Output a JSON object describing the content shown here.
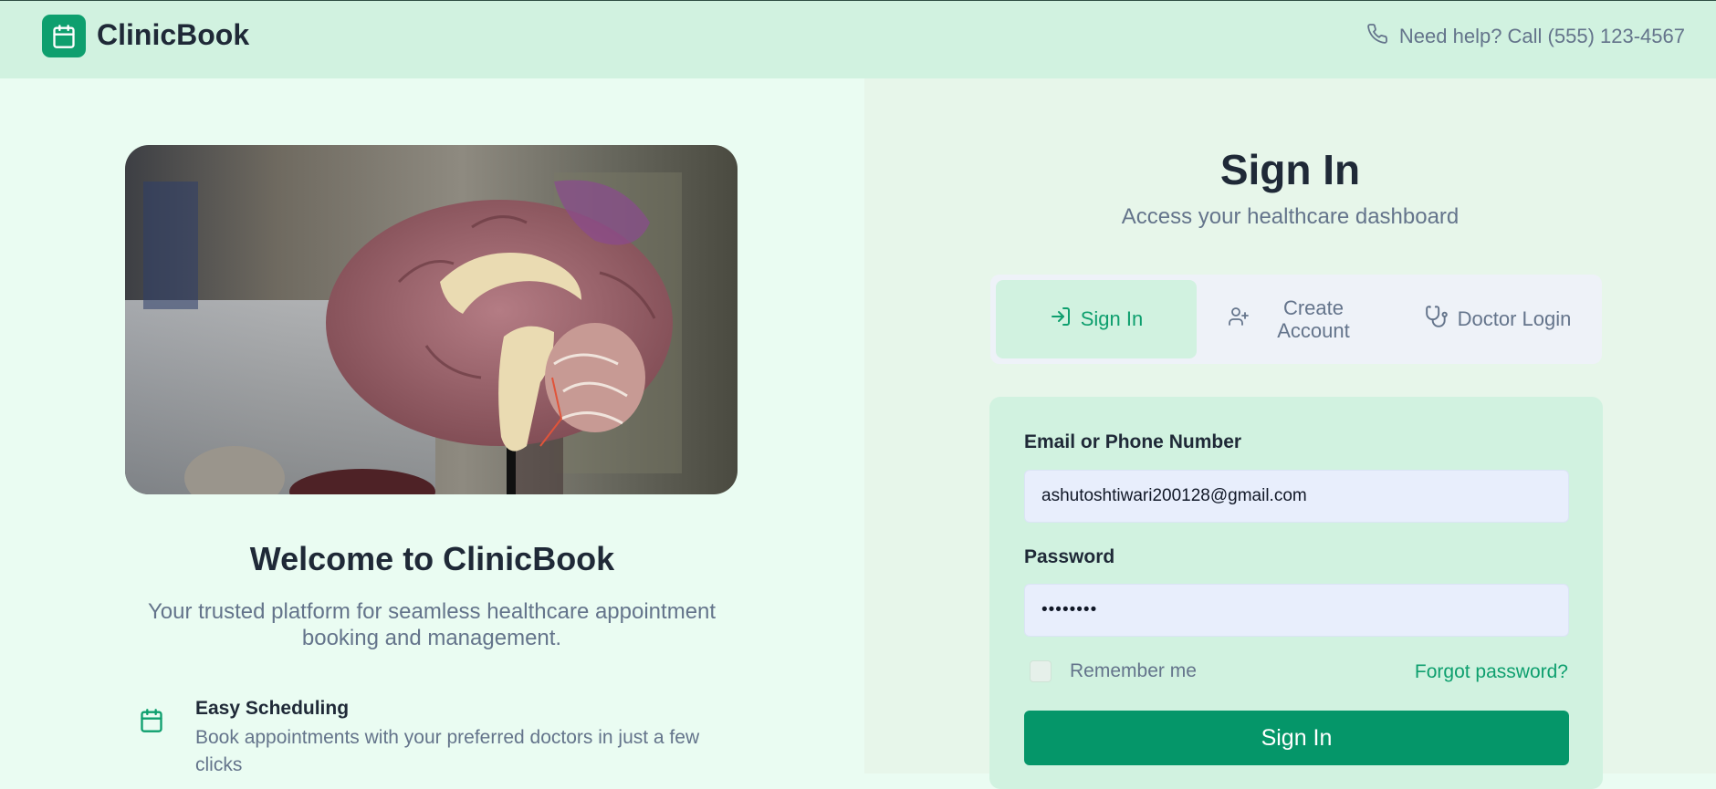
{
  "header": {
    "brand": "ClinicBook",
    "help_text": "Need help? Call (555) 123-4567"
  },
  "left": {
    "welcome_title": "Welcome to ClinicBook",
    "subtitle": "Your trusted platform for seamless healthcare appointment booking and management.",
    "feature": {
      "title": "Easy Scheduling",
      "description": "Book appointments with your preferred doctors in just a few clicks"
    }
  },
  "auth": {
    "title": "Sign In",
    "subtitle": "Access your healthcare dashboard",
    "tabs": [
      {
        "label": "Sign In",
        "icon": "sign-in-icon",
        "active": true
      },
      {
        "label": "Create Account",
        "icon": "user-plus-icon",
        "active": false
      },
      {
        "label": "Doctor Login",
        "icon": "stethoscope-icon",
        "active": false
      }
    ],
    "form": {
      "email_label": "Email or Phone Number",
      "email_value": "ashutoshtiwari200128@gmail.com",
      "password_label": "Password",
      "password_value": "••••••••",
      "remember_label": "Remember me",
      "forgot_label": "Forgot password?",
      "submit_label": "Sign In"
    }
  },
  "colors": {
    "accent": "#0e9f6e",
    "header_bg": "#d1f2e0",
    "button": "#059669"
  }
}
